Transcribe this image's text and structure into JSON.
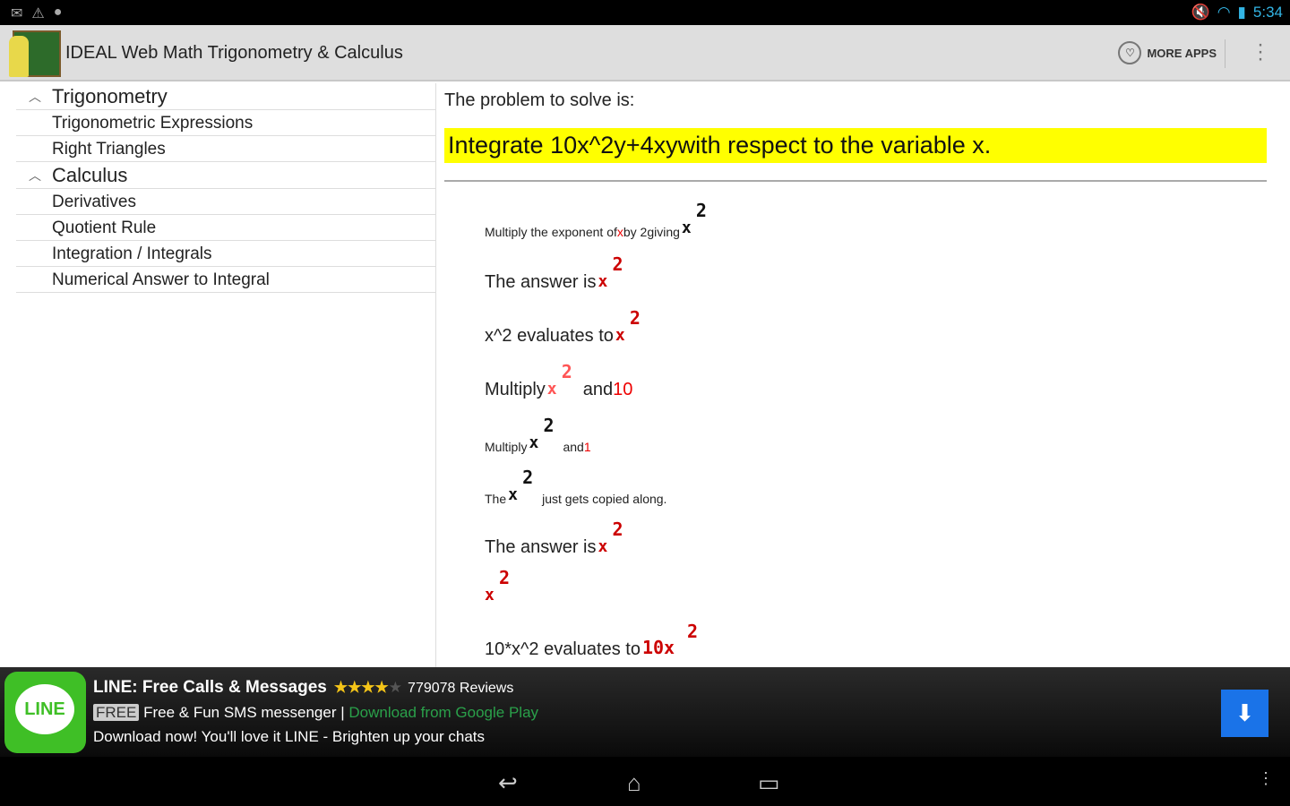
{
  "status": {
    "time": "5:34",
    "left_icons": [
      "gmail-icon",
      "warning-icon",
      "android-icon"
    ]
  },
  "app": {
    "title": "IDEAL Web Math Trigonometry & Calculus",
    "more_apps": "MORE APPS"
  },
  "sidebar": {
    "groups": [
      {
        "label": "Trigonometry",
        "items": [
          "Trigonometric Expressions",
          "Right Triangles"
        ]
      },
      {
        "label": "Calculus",
        "items": [
          "Derivatives",
          "Quotient Rule",
          "Integration / Integrals",
          "Numerical Answer to Integral"
        ]
      }
    ]
  },
  "main": {
    "lead": "The problem to solve is:",
    "problem": "Integrate 10x^2y+4xywith respect to the variable x.",
    "steps": {
      "s1a": "Multiply the exponent of ",
      "s1x": "x",
      "s1b": " by 2giving",
      "s2": "The answer is",
      "s3": "x^2 evaluates to ",
      "s4a": "Multiply",
      "s4b": "and ",
      "s4c": "10",
      "s5a": "Multiply",
      "s5b": "and ",
      "s5c": "1",
      "s6a": "The",
      "s6b": "just gets copied along.",
      "s7": "The answer is",
      "s9": "10*x^2 evaluates to ",
      "mx": "x",
      "m2": "2",
      "m10x": "10x"
    }
  },
  "ad": {
    "title": "LINE: Free Calls & Messages",
    "stars": "★★★★",
    "star_empty": "★",
    "reviews": "779078 Reviews",
    "free": "FREE",
    "tagline": "Free & Fun SMS messenger | ",
    "link": "Download from Google Play",
    "desc": "Download now! You'll love it LINE - Brighten up your chats",
    "icon_text": "LINE"
  }
}
